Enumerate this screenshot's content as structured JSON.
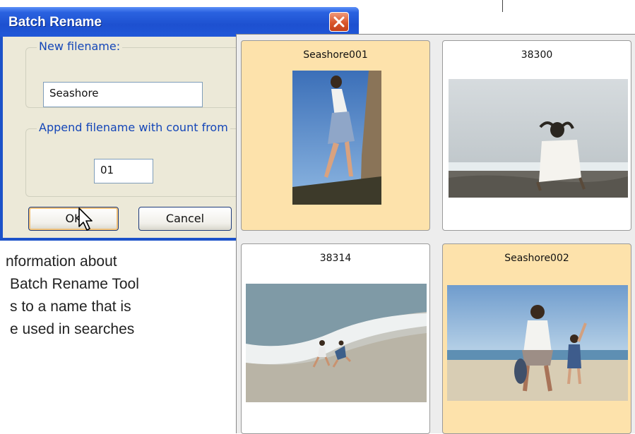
{
  "dialog": {
    "title": "Batch Rename",
    "new_filename_label": "New filename:",
    "new_filename_value": "Seashore",
    "append_label": "Append filename with count from",
    "count_value": "01",
    "ok_label": "OK",
    "cancel_label": "Cancel"
  },
  "thumbnails": [
    {
      "name": "Seashore001",
      "selected": true
    },
    {
      "name": "38300",
      "selected": false
    },
    {
      "name": "38314",
      "selected": false
    },
    {
      "name": "Seashore002",
      "selected": true
    }
  ],
  "background_text": [
    "nformation about",
    "Batch Rename Tool",
    "s to a name that is",
    "e used in searches"
  ],
  "colors": {
    "title_bar": "#1d50d0",
    "dialog_face": "#ece9d8",
    "selected_card": "#fde2ab",
    "close_button": "#d9562b",
    "group_label": "#1446b8"
  }
}
